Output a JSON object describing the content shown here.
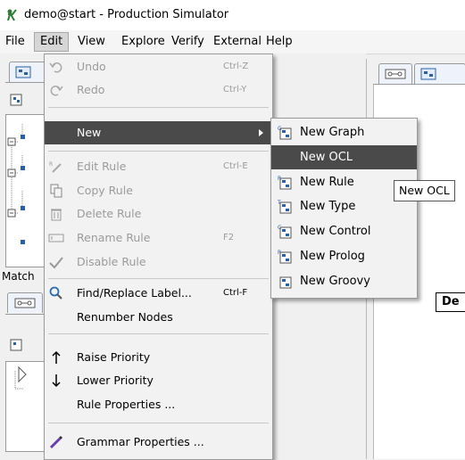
{
  "window": {
    "title": "demo@start - Production Simulator"
  },
  "menubar": {
    "items": [
      {
        "label": "File"
      },
      {
        "label": "Edit"
      },
      {
        "label": "View"
      },
      {
        "label": "Explore"
      },
      {
        "label": "Verify"
      },
      {
        "label": "External"
      },
      {
        "label": "Help"
      }
    ]
  },
  "background": {
    "match_label": "Match",
    "de_label": "De"
  },
  "edit_menu": {
    "items": [
      {
        "label": "Undo",
        "shortcut": "Ctrl-Z",
        "icon": "undo-icon"
      },
      {
        "label": "Redo",
        "shortcut": "Ctrl-Y",
        "icon": "redo-icon"
      },
      {
        "label": "New",
        "shortcut": "",
        "icon": ""
      },
      {
        "label": "Edit Rule",
        "shortcut": "Ctrl-E",
        "icon": "edit-rule-icon"
      },
      {
        "label": "Copy Rule",
        "shortcut": "",
        "icon": "copy-icon"
      },
      {
        "label": "Delete Rule",
        "shortcut": "",
        "icon": "trash-icon"
      },
      {
        "label": "Rename Rule",
        "shortcut": "F2",
        "icon": "rename-icon"
      },
      {
        "label": "Disable Rule",
        "shortcut": "",
        "icon": "check-icon"
      },
      {
        "label": "Find/Replace Label...",
        "shortcut": "Ctrl-F",
        "icon": "search-icon"
      },
      {
        "label": "Renumber Nodes",
        "shortcut": "",
        "icon": ""
      },
      {
        "label": "Raise Priority",
        "shortcut": "",
        "icon": "arrow-up-icon"
      },
      {
        "label": "Lower Priority",
        "shortcut": "",
        "icon": "arrow-down-icon"
      },
      {
        "label": "Rule Properties ...",
        "shortcut": "",
        "icon": ""
      },
      {
        "label": "Grammar Properties ...",
        "shortcut": "",
        "icon": "pencil-icon"
      }
    ]
  },
  "new_submenu": {
    "items": [
      {
        "label": "New Graph"
      },
      {
        "label": "New OCL"
      },
      {
        "label": "New Rule"
      },
      {
        "label": "New Type"
      },
      {
        "label": "New Control"
      },
      {
        "label": "New Prolog"
      },
      {
        "label": "New Groovy"
      }
    ]
  },
  "tooltip": {
    "text": "New OCL"
  },
  "colors": {
    "selection": "#4a4a4a",
    "menu_bg": "#f2f2f2",
    "disabled_text": "#9b9b9b"
  }
}
